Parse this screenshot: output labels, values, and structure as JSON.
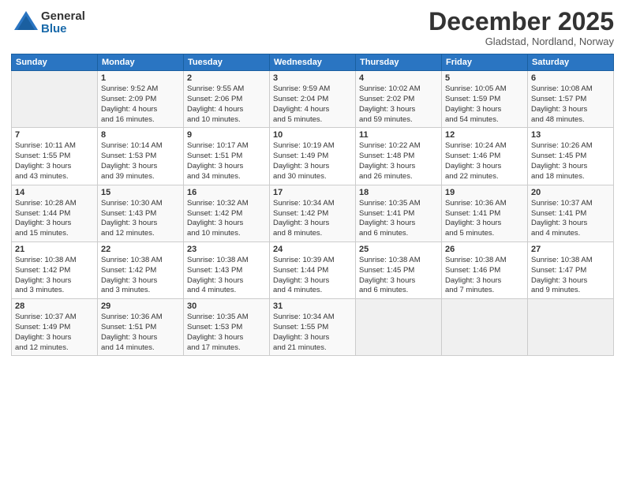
{
  "logo": {
    "general": "General",
    "blue": "Blue"
  },
  "header": {
    "month": "December 2025",
    "location": "Gladstad, Nordland, Norway"
  },
  "days_of_week": [
    "Sunday",
    "Monday",
    "Tuesday",
    "Wednesday",
    "Thursday",
    "Friday",
    "Saturday"
  ],
  "weeks": [
    [
      {
        "day": "",
        "info": ""
      },
      {
        "day": "1",
        "info": "Sunrise: 9:52 AM\nSunset: 2:09 PM\nDaylight: 4 hours\nand 16 minutes."
      },
      {
        "day": "2",
        "info": "Sunrise: 9:55 AM\nSunset: 2:06 PM\nDaylight: 4 hours\nand 10 minutes."
      },
      {
        "day": "3",
        "info": "Sunrise: 9:59 AM\nSunset: 2:04 PM\nDaylight: 4 hours\nand 5 minutes."
      },
      {
        "day": "4",
        "info": "Sunrise: 10:02 AM\nSunset: 2:02 PM\nDaylight: 3 hours\nand 59 minutes."
      },
      {
        "day": "5",
        "info": "Sunrise: 10:05 AM\nSunset: 1:59 PM\nDaylight: 3 hours\nand 54 minutes."
      },
      {
        "day": "6",
        "info": "Sunrise: 10:08 AM\nSunset: 1:57 PM\nDaylight: 3 hours\nand 48 minutes."
      }
    ],
    [
      {
        "day": "7",
        "info": "Sunrise: 10:11 AM\nSunset: 1:55 PM\nDaylight: 3 hours\nand 43 minutes."
      },
      {
        "day": "8",
        "info": "Sunrise: 10:14 AM\nSunset: 1:53 PM\nDaylight: 3 hours\nand 39 minutes."
      },
      {
        "day": "9",
        "info": "Sunrise: 10:17 AM\nSunset: 1:51 PM\nDaylight: 3 hours\nand 34 minutes."
      },
      {
        "day": "10",
        "info": "Sunrise: 10:19 AM\nSunset: 1:49 PM\nDaylight: 3 hours\nand 30 minutes."
      },
      {
        "day": "11",
        "info": "Sunrise: 10:22 AM\nSunset: 1:48 PM\nDaylight: 3 hours\nand 26 minutes."
      },
      {
        "day": "12",
        "info": "Sunrise: 10:24 AM\nSunset: 1:46 PM\nDaylight: 3 hours\nand 22 minutes."
      },
      {
        "day": "13",
        "info": "Sunrise: 10:26 AM\nSunset: 1:45 PM\nDaylight: 3 hours\nand 18 minutes."
      }
    ],
    [
      {
        "day": "14",
        "info": "Sunrise: 10:28 AM\nSunset: 1:44 PM\nDaylight: 3 hours\nand 15 minutes."
      },
      {
        "day": "15",
        "info": "Sunrise: 10:30 AM\nSunset: 1:43 PM\nDaylight: 3 hours\nand 12 minutes."
      },
      {
        "day": "16",
        "info": "Sunrise: 10:32 AM\nSunset: 1:42 PM\nDaylight: 3 hours\nand 10 minutes."
      },
      {
        "day": "17",
        "info": "Sunrise: 10:34 AM\nSunset: 1:42 PM\nDaylight: 3 hours\nand 8 minutes."
      },
      {
        "day": "18",
        "info": "Sunrise: 10:35 AM\nSunset: 1:41 PM\nDaylight: 3 hours\nand 6 minutes."
      },
      {
        "day": "19",
        "info": "Sunrise: 10:36 AM\nSunset: 1:41 PM\nDaylight: 3 hours\nand 5 minutes."
      },
      {
        "day": "20",
        "info": "Sunrise: 10:37 AM\nSunset: 1:41 PM\nDaylight: 3 hours\nand 4 minutes."
      }
    ],
    [
      {
        "day": "21",
        "info": "Sunrise: 10:38 AM\nSunset: 1:42 PM\nDaylight: 3 hours\nand 3 minutes."
      },
      {
        "day": "22",
        "info": "Sunrise: 10:38 AM\nSunset: 1:42 PM\nDaylight: 3 hours\nand 3 minutes."
      },
      {
        "day": "23",
        "info": "Sunrise: 10:38 AM\nSunset: 1:43 PM\nDaylight: 3 hours\nand 4 minutes."
      },
      {
        "day": "24",
        "info": "Sunrise: 10:39 AM\nSunset: 1:44 PM\nDaylight: 3 hours\nand 4 minutes."
      },
      {
        "day": "25",
        "info": "Sunrise: 10:38 AM\nSunset: 1:45 PM\nDaylight: 3 hours\nand 6 minutes."
      },
      {
        "day": "26",
        "info": "Sunrise: 10:38 AM\nSunset: 1:46 PM\nDaylight: 3 hours\nand 7 minutes."
      },
      {
        "day": "27",
        "info": "Sunrise: 10:38 AM\nSunset: 1:47 PM\nDaylight: 3 hours\nand 9 minutes."
      }
    ],
    [
      {
        "day": "28",
        "info": "Sunrise: 10:37 AM\nSunset: 1:49 PM\nDaylight: 3 hours\nand 12 minutes."
      },
      {
        "day": "29",
        "info": "Sunrise: 10:36 AM\nSunset: 1:51 PM\nDaylight: 3 hours\nand 14 minutes."
      },
      {
        "day": "30",
        "info": "Sunrise: 10:35 AM\nSunset: 1:53 PM\nDaylight: 3 hours\nand 17 minutes."
      },
      {
        "day": "31",
        "info": "Sunrise: 10:34 AM\nSunset: 1:55 PM\nDaylight: 3 hours\nand 21 minutes."
      },
      {
        "day": "",
        "info": ""
      },
      {
        "day": "",
        "info": ""
      },
      {
        "day": "",
        "info": ""
      }
    ]
  ]
}
